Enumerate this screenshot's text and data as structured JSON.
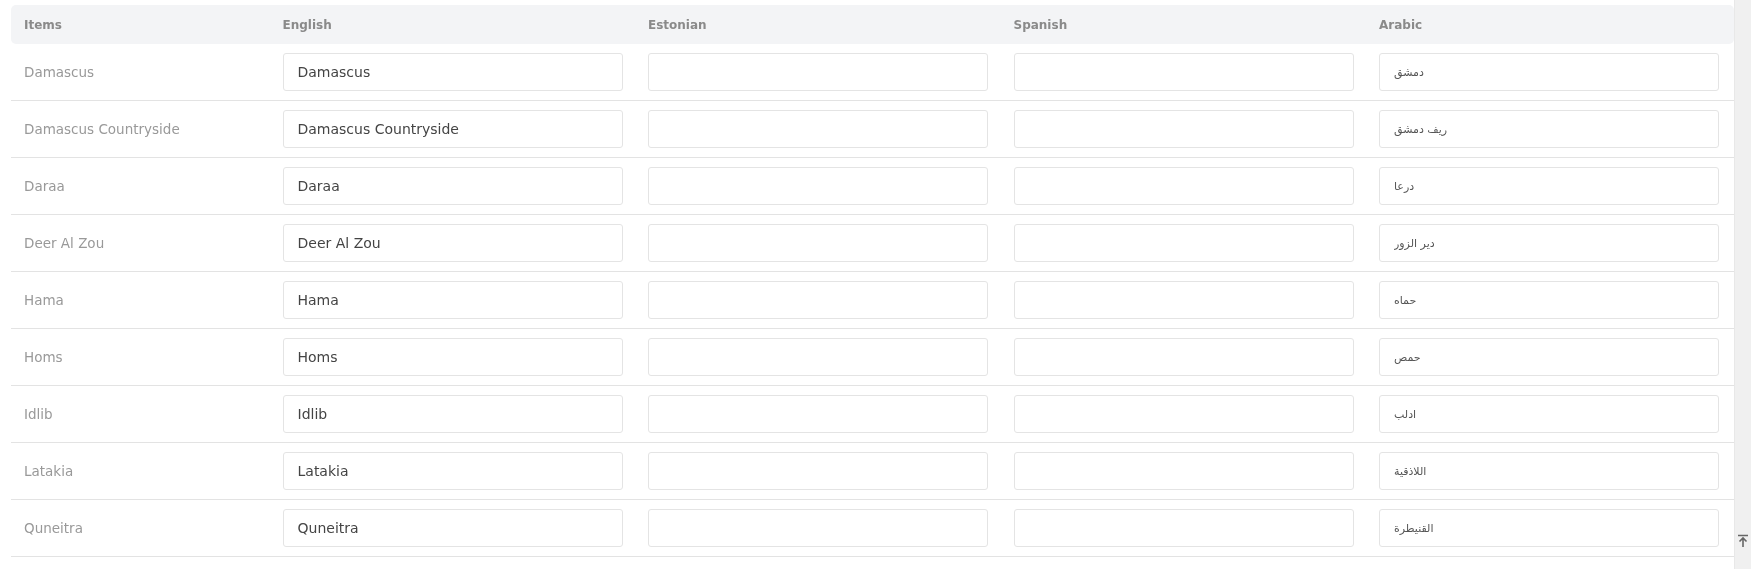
{
  "table": {
    "columns": [
      "Items",
      "English",
      "Estonian",
      "Spanish",
      "Arabic"
    ],
    "rows": [
      {
        "item": "Damascus",
        "english": "Damascus",
        "arabic": "دمشق"
      },
      {
        "item": "Damascus Countryside",
        "english": "Damascus Countryside",
        "arabic": "ريف دمشق"
      },
      {
        "item": "Daraa",
        "english": "Daraa",
        "arabic": "درعا"
      },
      {
        "item": "Deer Al Zou",
        "english": "Deer Al Zou",
        "arabic": "دير الزور"
      },
      {
        "item": "Hama",
        "english": "Hama",
        "arabic": "حماه"
      },
      {
        "item": "Homs",
        "english": "Homs",
        "arabic": "حمص"
      },
      {
        "item": "Idlib",
        "english": "Idlib",
        "arabic": "ادلب"
      },
      {
        "item": "Latakia",
        "english": "Latakia",
        "arabic": "اللاذقية"
      },
      {
        "item": "Quneitra",
        "english": "Quneitra",
        "arabic": "القنيطرة"
      }
    ]
  }
}
